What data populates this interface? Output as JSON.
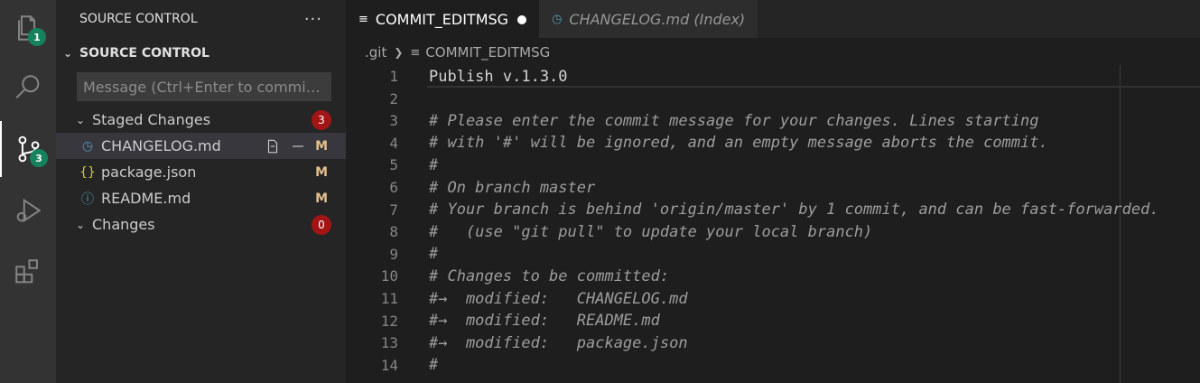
{
  "activity_bar": {
    "explorer_badge": "1",
    "scm_badge": "3"
  },
  "sidebar": {
    "header_title": "SOURCE CONTROL",
    "more_label": "···",
    "section_title": "SOURCE CONTROL",
    "message_placeholder": "Message (Ctrl+Enter to commit o...",
    "staged_label": "Staged Changes",
    "staged_count": "3",
    "changes_label": "Changes",
    "changes_count": "0",
    "staged_files": [
      {
        "name": "CHANGELOG.md",
        "status": "M",
        "icon": "clock-icon"
      },
      {
        "name": "package.json",
        "status": "M",
        "icon": "json-icon"
      },
      {
        "name": "README.md",
        "status": "M",
        "icon": "info-icon"
      }
    ]
  },
  "editor": {
    "tabs": [
      {
        "label": "COMMIT_EDITMSG",
        "active": true,
        "dirty": true
      },
      {
        "label": "CHANGELOG.md (Index)",
        "active": false
      }
    ],
    "breadcrumb": [
      ".git",
      "COMMIT_EDITMSG"
    ],
    "lines": [
      {
        "n": "1",
        "text": "Publish v.1.3.0"
      },
      {
        "n": "2",
        "text": ""
      },
      {
        "n": "3",
        "text": "# Please enter the commit message for your changes. Lines starting"
      },
      {
        "n": "4",
        "text": "# with '#' will be ignored, and an empty message aborts the commit."
      },
      {
        "n": "5",
        "text": "#"
      },
      {
        "n": "6",
        "text": "# On branch master"
      },
      {
        "n": "7",
        "text": "# Your branch is behind 'origin/master' by 1 commit, and can be fast-forwarded."
      },
      {
        "n": "8",
        "text": "#   (use \"git pull\" to update your local branch)"
      },
      {
        "n": "9",
        "text": "#"
      },
      {
        "n": "10",
        "text": "# Changes to be committed:"
      },
      {
        "n": "11",
        "text": "#→  modified:   CHANGELOG.md"
      },
      {
        "n": "12",
        "text": "#→  modified:   README.md"
      },
      {
        "n": "13",
        "text": "#→  modified:   package.json"
      },
      {
        "n": "14",
        "text": "#"
      }
    ]
  }
}
